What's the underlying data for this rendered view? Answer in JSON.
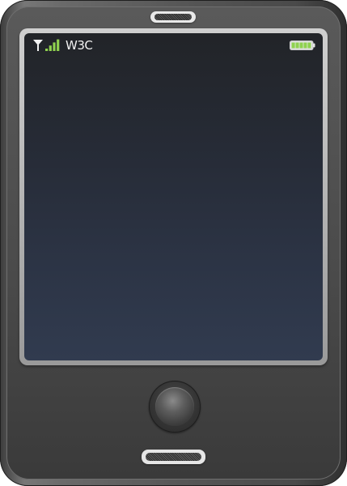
{
  "status_bar": {
    "carrier": "W3C",
    "signal_level": 4,
    "signal_max": 4,
    "battery_level": 1.0,
    "battery_color": "#8fd14f",
    "icons": {
      "antenna": "antenna-icon",
      "signal": "signal-strength-icon",
      "battery": "battery-full-icon"
    }
  },
  "device": {
    "body_color": "#4f4f4f",
    "screen_color": "#2a3140",
    "controls": {
      "home_button": "home-button",
      "top_speaker": "earpiece-speaker",
      "bottom_speaker": "microphone-grill"
    }
  }
}
